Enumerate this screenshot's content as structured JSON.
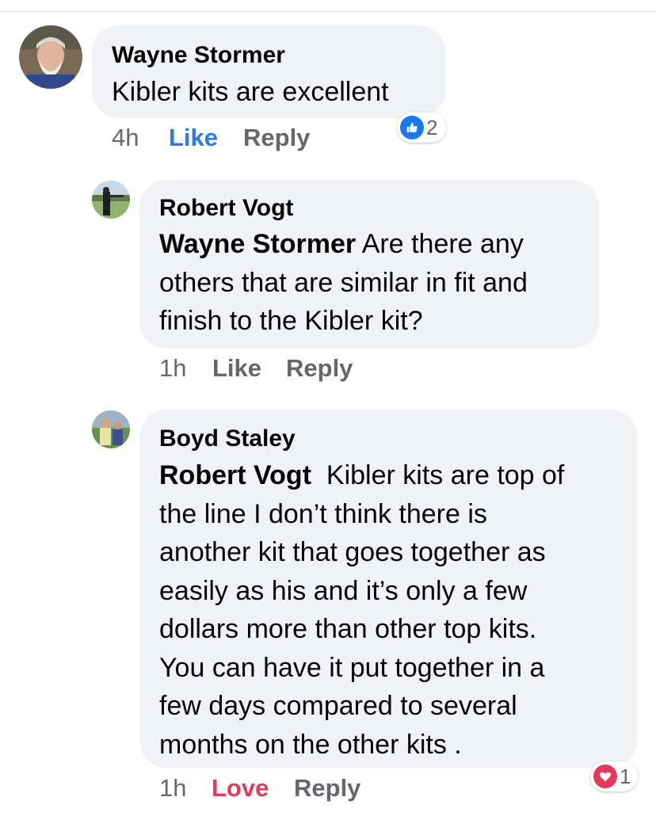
{
  "comments": [
    {
      "author": "Wayne Stormer",
      "mention": "",
      "text": "Kibler kits are excellent",
      "time": "4h",
      "like_label": "Like",
      "reply_label": "Reply",
      "reaction": {
        "icon": "thumbs-up-icon",
        "count": "2",
        "color": "#1877f2"
      }
    },
    {
      "author": "Robert Vogt",
      "mention": "Wayne Stormer",
      "text_lines": [
        " Are there any",
        "others that are similar in fit and",
        "finish to the Kibler kit?"
      ],
      "time": "1h",
      "like_label": "Like",
      "reply_label": "Reply"
    },
    {
      "author": "Boyd Staley",
      "mention": "Robert Vogt",
      "text_lines": [
        "  Kibler kits are top of",
        "the line I don’t think there is",
        "another kit that goes together as",
        "easily as his and it’s only a few",
        "dollars more than other top kits.",
        "You can have it put together in a",
        "few days compared to several",
        "months on the other kits ."
      ],
      "time": "1h",
      "love_label": "Love",
      "reply_label": "Reply",
      "reaction": {
        "icon": "heart-icon",
        "count": "1",
        "color": "#e33b57"
      }
    }
  ]
}
